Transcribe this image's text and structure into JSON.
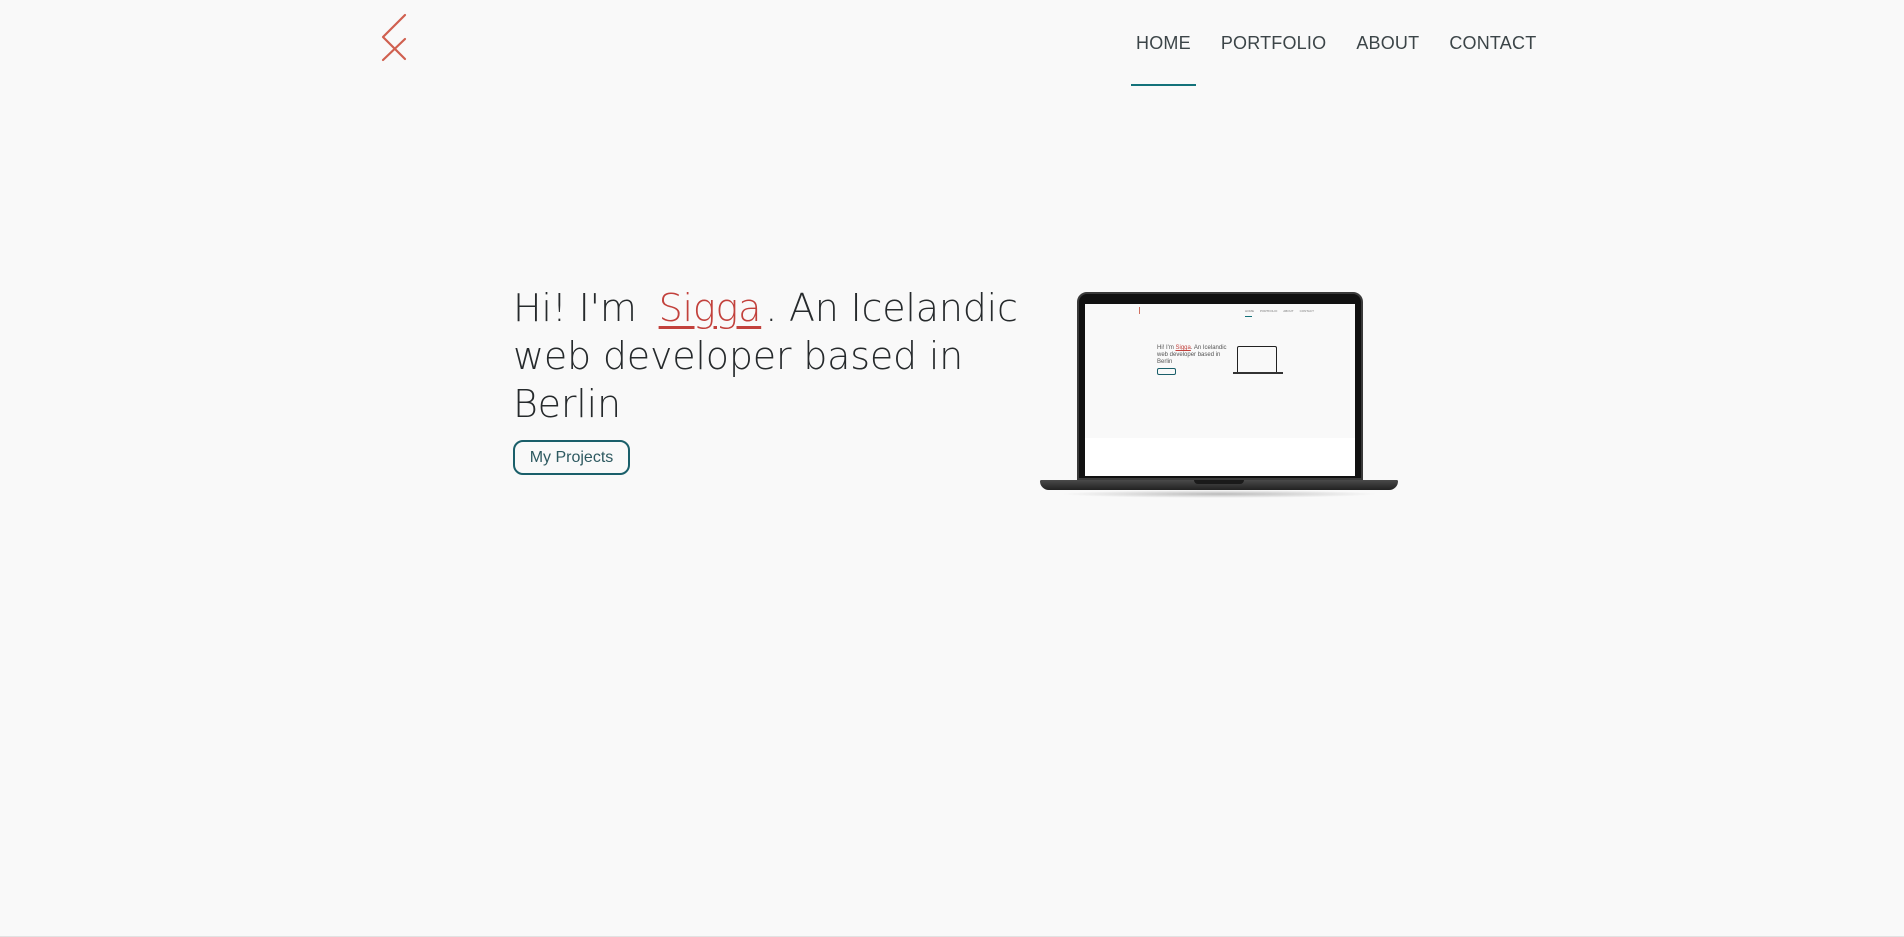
{
  "header": {
    "logo_icon": "sigga-monogram-icon",
    "nav": [
      {
        "label": "HOME",
        "active": true
      },
      {
        "label": "PORTFOLIO",
        "active": false
      },
      {
        "label": "ABOUT",
        "active": false
      },
      {
        "label": "CONTACT",
        "active": false
      }
    ]
  },
  "hero": {
    "greeting": "Hi! I'm",
    "name": "Sigga",
    "tagline": ". An Icelandic web developer based in Berlin",
    "button_label": "My Projects"
  },
  "laptop_preview": {
    "icon": "laptop-icon",
    "mini_text_prefix": "Hi! I'm",
    "mini_name": "Sigga",
    "mini_text_suffix": ". An Icelandic web developer based in Berlin"
  },
  "colors": {
    "background": "#f9f9f9",
    "accent_teal": "#13727a",
    "accent_red": "#c2413c",
    "text_dark": "#262a2c"
  }
}
